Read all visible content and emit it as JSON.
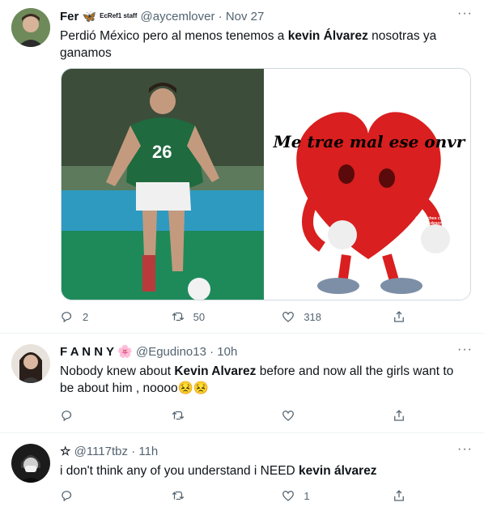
{
  "tweets": [
    {
      "name": "Fer",
      "badge": "EcRef1 staff",
      "handle": "@aycemlover",
      "time": "Nov 27",
      "text_parts": [
        "Perdió México pero al menos tenemos a ",
        "kevin Álvarez",
        " nosotras ya ganamos"
      ],
      "replies": "2",
      "retweets": "50",
      "likes": "318",
      "media_caption": "Me trae mal ese onvr",
      "media_small": "@peluches con texto que me describen jd",
      "jersey_number": "26"
    },
    {
      "name": "F A N N Y",
      "handle": "@Egudino13",
      "time": "10h",
      "text_parts": [
        "Nobody knew about ",
        "Kevin Alvarez",
        " before and now all the girls want to be about him , noooo😣😣"
      ],
      "replies": "",
      "retweets": "",
      "likes": ""
    },
    {
      "name": "☆",
      "handle": "@1117tbz",
      "time": "11h",
      "text_parts": [
        "i don't think any of you understand i NEED ",
        "kevin álvarez",
        ""
      ],
      "replies": "",
      "retweets": "",
      "likes": "1"
    }
  ],
  "more_label": "···",
  "dot": "·",
  "icons": {
    "reply": "reply-icon",
    "retweet": "retweet-icon",
    "like": "heart-icon",
    "share": "share-icon",
    "more": "more-options-icon"
  }
}
